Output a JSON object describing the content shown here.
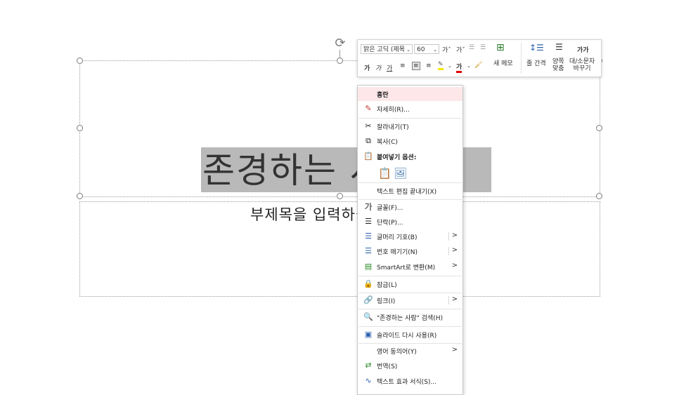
{
  "slide": {
    "title_text": "존경하는 사람",
    "subtitle_text": "부제목을 입력하십시오"
  },
  "mini_toolbar": {
    "font_name": "맑은 고딕 (제목",
    "font_size": "60",
    "grow_font": "가ˆ",
    "shrink_font": "가ˇ",
    "bold": "가",
    "italic": "가",
    "underline": "가",
    "font_color": "가",
    "new_comment": "새 메모",
    "line_spacing": "줄 간격",
    "justify": "양쪽\n맞춤",
    "change_case_top": "가가",
    "change_case": "대/소문자\n바꾸기"
  },
  "context_menu": {
    "items": [
      {
        "label": "흥란"
      },
      {
        "label": "자세히(R)..."
      },
      {
        "label": "잘라내기(T)"
      },
      {
        "label": "복사(C)"
      },
      {
        "label": "붙여넣기 옵션:"
      },
      {
        "label": "텍스트 편집 끝내기(X)"
      },
      {
        "label": "글꼴(F)..."
      },
      {
        "label": "단락(P)..."
      },
      {
        "label": "글머리 기호(B)"
      },
      {
        "label": "번호 매기기(N)"
      },
      {
        "label": "SmartArt로 변환(M)"
      },
      {
        "label": "잠금(L)"
      },
      {
        "label": "링크(I)"
      },
      {
        "label": "\"존경하는 사람\" 검색(H)"
      },
      {
        "label": "슬라이드 다시 사용(R)"
      },
      {
        "label": "영어 동의어(Y)"
      },
      {
        "label": "번역(S)"
      },
      {
        "label": "텍스트 효과 서식(S)..."
      }
    ]
  },
  "colors": {
    "accent_red": "#e00000",
    "highlight_yellow": "#f5e400",
    "menu_hover": "#fde7e9",
    "selection_gray": "#b9b9b9"
  }
}
